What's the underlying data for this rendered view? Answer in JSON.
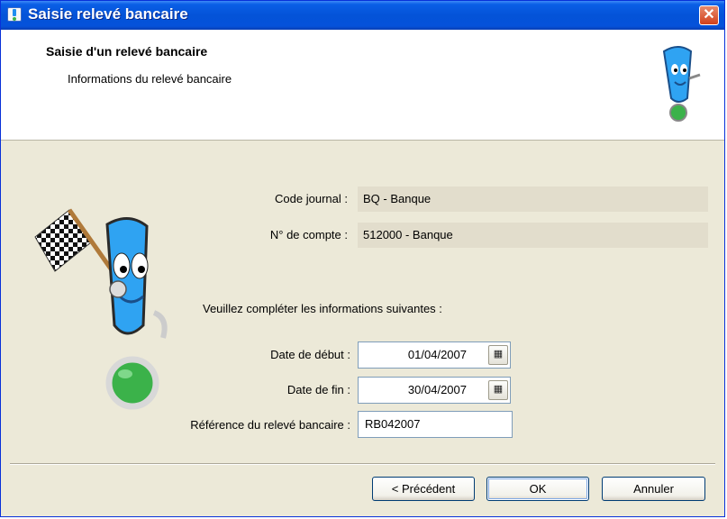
{
  "window": {
    "title": "Saisie relevé bancaire",
    "close_glyph": "✕"
  },
  "header": {
    "title": "Saisie d'un relevé bancaire",
    "subtitle": "Informations du relevé bancaire"
  },
  "info": {
    "code_journal_label": "Code journal :",
    "code_journal_value": "BQ - Banque",
    "compte_label": "N° de compte :",
    "compte_value": "512000 - Banque"
  },
  "form": {
    "instruction": "Veuillez compléter les informations suivantes :",
    "date_debut_label": "Date de début :",
    "date_debut_value": "01/04/2007",
    "date_fin_label": "Date de fin :",
    "date_fin_value": "30/04/2007",
    "reference_label": "Référence du relevé bancaire :",
    "reference_value": "RB042007",
    "calendar_icon": "calendar-icon",
    "calendar_glyph": "▦"
  },
  "buttons": {
    "previous": "< Précédent",
    "ok": "OK",
    "cancel": "Annuler"
  },
  "colors": {
    "titlebar": "#0453d8",
    "panel": "#ece9d8",
    "readonly_field": "#e2ddcc",
    "mascot_blue": "#2fa3f2",
    "mascot_green": "#3bb24a"
  }
}
